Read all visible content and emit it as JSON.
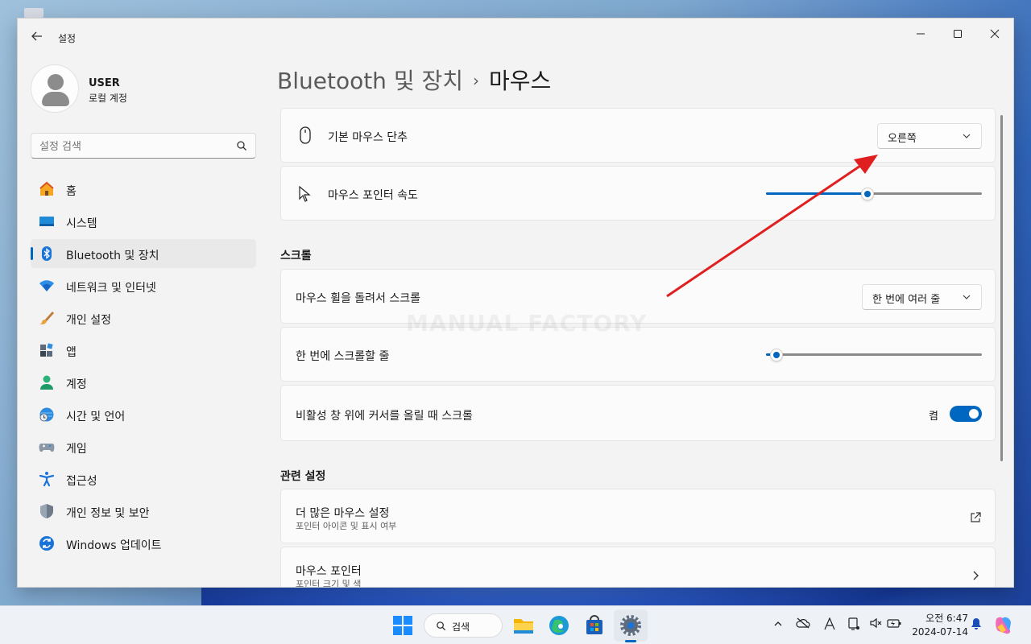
{
  "window": {
    "app_title": "설정"
  },
  "profile": {
    "name": "USER",
    "account_type": "로컬 계정"
  },
  "search": {
    "placeholder": "설정 검색"
  },
  "sidebar": {
    "items": [
      {
        "label": "홈",
        "icon": "home-icon"
      },
      {
        "label": "시스템",
        "icon": "system-icon"
      },
      {
        "label": "Bluetooth 및 장치",
        "icon": "bluetooth-icon",
        "active": true
      },
      {
        "label": "네트워크 및 인터넷",
        "icon": "network-icon"
      },
      {
        "label": "개인 설정",
        "icon": "brush-icon"
      },
      {
        "label": "앱",
        "icon": "apps-icon"
      },
      {
        "label": "계정",
        "icon": "account-icon"
      },
      {
        "label": "시간 및 언어",
        "icon": "globe-clock-icon"
      },
      {
        "label": "게임",
        "icon": "gamepad-icon"
      },
      {
        "label": "접근성",
        "icon": "accessibility-icon"
      },
      {
        "label": "개인 정보 및 보안",
        "icon": "shield-icon"
      },
      {
        "label": "Windows 업데이트",
        "icon": "update-icon"
      }
    ]
  },
  "breadcrumb": {
    "parent": "Bluetooth 및 장치",
    "separator": "›",
    "current": "마우스"
  },
  "mouse": {
    "primary_button": {
      "label": "기본 마우스 단추",
      "value": "오른쪽"
    },
    "pointer_speed": {
      "label": "마우스 포인터 속도",
      "value_fraction": 0.47
    }
  },
  "scroll": {
    "title": "스크롤",
    "wheel_scroll": {
      "label": "마우스 휠을 돌려서 스크롤",
      "value": "한 번에 여러 줄"
    },
    "lines_per_scroll": {
      "label": "한 번에 스크롤할 줄",
      "value_fraction": 0.05
    },
    "inactive_scroll": {
      "label": "비활성 창 위에 커서를 올릴 때 스크롤",
      "state_label": "켬",
      "on": true
    }
  },
  "related": {
    "title": "관련 설정",
    "items": [
      {
        "label": "더 많은 마우스 설정",
        "sub": "포인터 아이콘 및 표시 여부",
        "icon": "external-link-icon"
      },
      {
        "label": "마우스 포인터",
        "sub": "포인터 크기 및 색",
        "icon": "chevron-right-icon"
      }
    ]
  },
  "watermark": "MANUAL FACTORY",
  "taskbar": {
    "search_label": "검색",
    "clock_time": "오전 6:47",
    "clock_date": "2024-07-14"
  },
  "colors": {
    "accent": "#0067c0",
    "annotation_arrow": "#e02020"
  }
}
